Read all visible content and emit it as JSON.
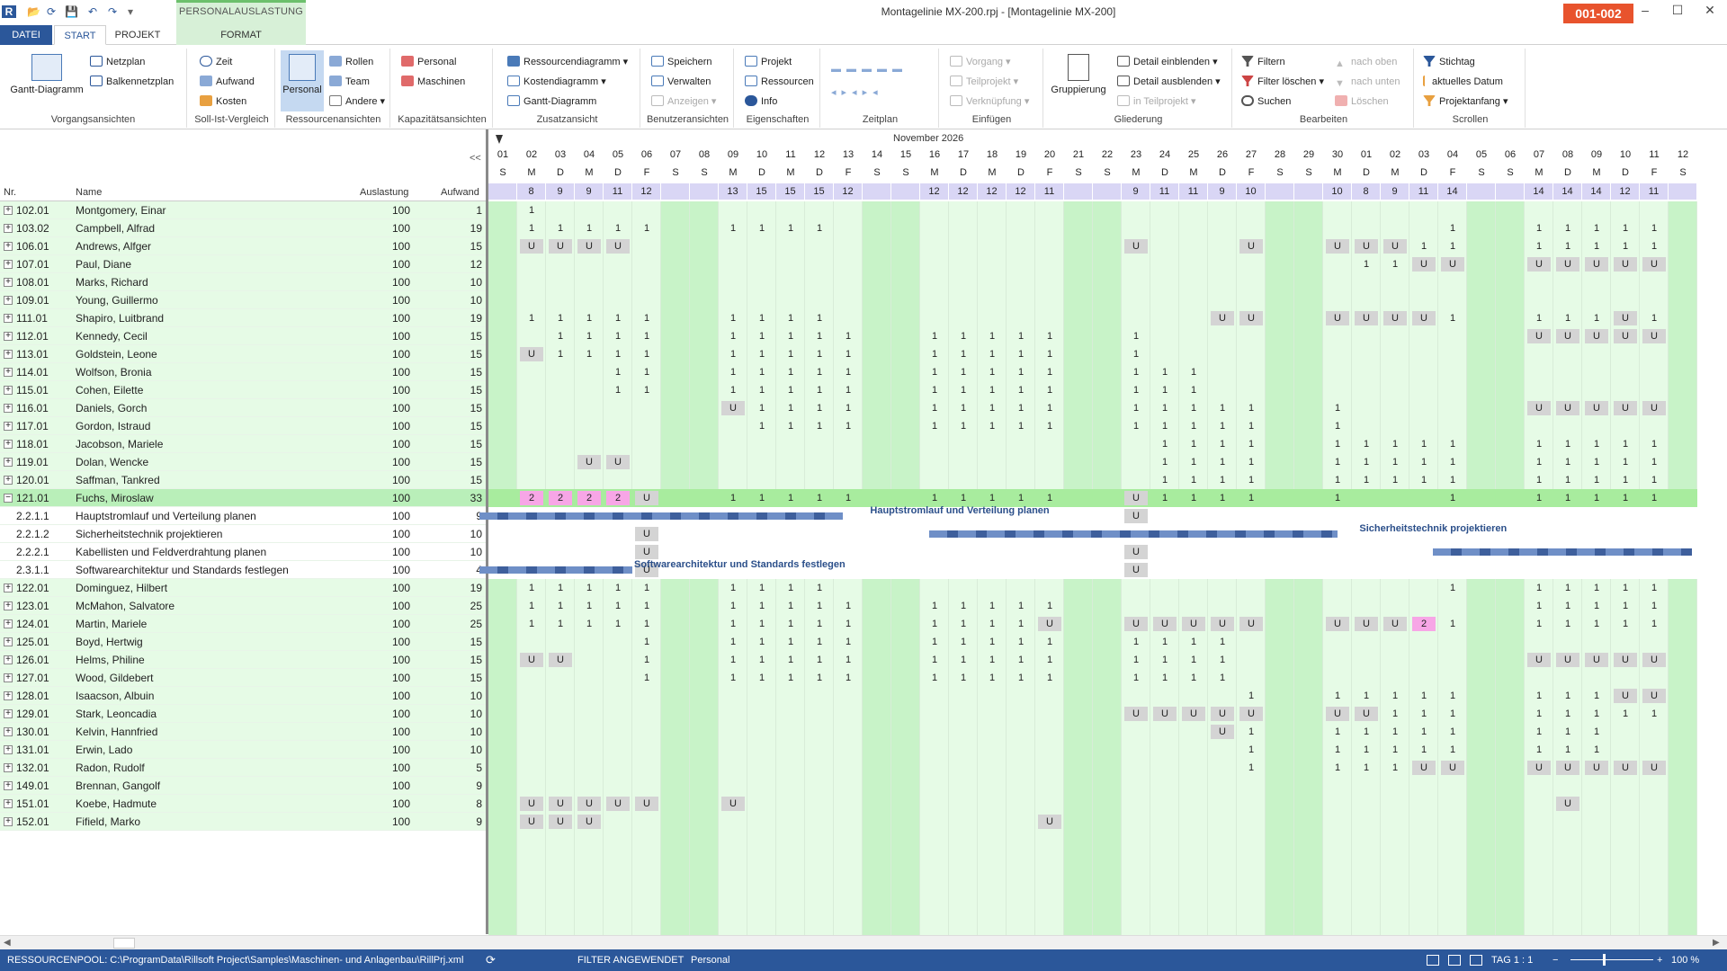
{
  "titlebar": {
    "title": "Montagelinie MX-200.rpj - [Montagelinie MX-200]",
    "context_group": "PERSONALAUSLASTUNG",
    "badge": "001-002",
    "min": "–",
    "max": "☐",
    "close": "✕"
  },
  "tabs": {
    "file": "DATEI",
    "start": "START",
    "project": "PROJEKT",
    "format": "FORMAT"
  },
  "ribbon": {
    "vorgangsansichten": {
      "label": "Vorgangsansichten",
      "gantt": "Gantt-Diagramm",
      "netzplan": "Netzplan",
      "balken": "Balkennetzplan"
    },
    "sollist": {
      "label": "Soll-Ist-Vergleich",
      "zeit": "Zeit",
      "aufwand": "Aufwand",
      "kosten": "Kosten"
    },
    "ressourcen": {
      "label": "Ressourcenansichten",
      "personal": "Personal",
      "rollen": "Rollen",
      "team": "Team",
      "andere": "Andere"
    },
    "kapazitaet": {
      "label": "Kapazitätsansichten",
      "personal": "Personal",
      "maschinen": "Maschinen"
    },
    "zusatz": {
      "label": "Zusatzansicht",
      "rdiagramm": "Ressourcendiagramm",
      "kdiagramm": "Kostendiagramm",
      "gantt": "Gantt-Diagramm"
    },
    "benutzer": {
      "label": "Benutzeransichten",
      "speichern": "Speichern",
      "verwalten": "Verwalten",
      "anzeigen": "Anzeigen"
    },
    "eigenschaften": {
      "label": "Eigenschaften",
      "projekt": "Projekt",
      "ressourcen": "Ressourcen",
      "info": "Info"
    },
    "zeitplan": {
      "label": "Zeitplan"
    },
    "einfuegen": {
      "label": "Einfügen",
      "vorgang": "Vorgang",
      "teilprojekt": "Teilprojekt",
      "verknuepfung": "Verknüpfung"
    },
    "gliederung": {
      "label": "Gliederung",
      "gruppierung": "Gruppierung",
      "einblenden": "Detail einblenden",
      "ausblenden": "Detail ausblenden",
      "teilprojekt": "in Teilprojekt"
    },
    "bearbeiten": {
      "label": "Bearbeiten",
      "filtern": "Filtern",
      "filterloeschen": "Filter löschen",
      "suchen": "Suchen",
      "oben": "nach oben",
      "unten": "nach unten",
      "loeschen": "Löschen"
    },
    "scrollen": {
      "label": "Scrollen",
      "stichtag": "Stichtag",
      "aktuell": "aktuelles Datum",
      "projektanfang": "Projektanfang"
    }
  },
  "table": {
    "col_nr": "Nr.",
    "col_name": "Name",
    "col_auslastung": "Auslastung",
    "col_aufwand": "Aufwand",
    "collapse": "<<"
  },
  "timeline": {
    "month": "November 2026",
    "days": [
      "01",
      "02",
      "03",
      "04",
      "05",
      "06",
      "07",
      "08",
      "09",
      "10",
      "11",
      "12",
      "13",
      "14",
      "15",
      "16",
      "17",
      "18",
      "19",
      "20",
      "21",
      "22",
      "23",
      "24",
      "25",
      "26",
      "27",
      "28",
      "29",
      "30",
      "01",
      "02",
      "03",
      "04",
      "05",
      "06",
      "07",
      "08",
      "09",
      "10",
      "11",
      "12"
    ],
    "letters": [
      "S",
      "M",
      "D",
      "M",
      "D",
      "F",
      "S",
      "S",
      "M",
      "D",
      "M",
      "D",
      "F",
      "S",
      "S",
      "M",
      "D",
      "M",
      "D",
      "F",
      "S",
      "S",
      "M",
      "D",
      "M",
      "D",
      "F",
      "S",
      "S",
      "M",
      "D",
      "M",
      "D",
      "F",
      "S",
      "S",
      "M",
      "D",
      "M",
      "D",
      "F",
      "S"
    ],
    "capacity": [
      "",
      "8",
      "9",
      "9",
      "11",
      "12",
      "",
      "",
      "13",
      "15",
      "15",
      "15",
      "12",
      "",
      "",
      "12",
      "12",
      "12",
      "12",
      "11",
      "",
      "",
      "9",
      "11",
      "11",
      "9",
      "10",
      "",
      "",
      "10",
      "8",
      "9",
      "11",
      "14",
      "",
      "",
      "14",
      "14",
      "14",
      "12",
      "11",
      ""
    ]
  },
  "rows": [
    {
      "nr": "102.01",
      "name": "Montgomery, Einar",
      "ausl": "100",
      "aufw": "1",
      "exp": "+",
      "v": {
        "1": "1"
      }
    },
    {
      "nr": "103.02",
      "name": "Campbell, Alfrad",
      "ausl": "100",
      "aufw": "19",
      "exp": "+",
      "v": {
        "1": "1",
        "2": "1",
        "3": "1",
        "4": "1",
        "5": "1",
        "8": "1",
        "9": "1",
        "10": "1",
        "11": "1",
        "33": "1",
        "36": "1",
        "37": "1",
        "38": "1",
        "39": "1",
        "40": "1"
      }
    },
    {
      "nr": "106.01",
      "name": "Andrews, Alfger",
      "ausl": "100",
      "aufw": "15",
      "exp": "+",
      "v": {
        "1": "U",
        "2": "U",
        "3": "U",
        "4": "U",
        "22": "U",
        "26": "U",
        "29": "U",
        "30": "U",
        "31": "U",
        "32": "1",
        "33": "1",
        "36": "1",
        "37": "1",
        "38": "1",
        "39": "1",
        "40": "1"
      }
    },
    {
      "nr": "107.01",
      "name": "Paul, Diane",
      "ausl": "100",
      "aufw": "12",
      "exp": "+",
      "v": {
        "30": "1",
        "31": "1",
        "32": "U",
        "33": "U",
        "36": "U",
        "37": "U",
        "38": "U",
        "39": "U",
        "40": "U"
      }
    },
    {
      "nr": "108.01",
      "name": "Marks, Richard",
      "ausl": "100",
      "aufw": "10",
      "exp": "+",
      "v": {}
    },
    {
      "nr": "109.01",
      "name": "Young, Guillermo",
      "ausl": "100",
      "aufw": "10",
      "exp": "+",
      "v": {}
    },
    {
      "nr": "111.01",
      "name": "Shapiro, Luitbrand",
      "ausl": "100",
      "aufw": "19",
      "exp": "+",
      "v": {
        "1": "1",
        "2": "1",
        "3": "1",
        "4": "1",
        "5": "1",
        "8": "1",
        "9": "1",
        "10": "1",
        "11": "1",
        "25": "U",
        "26": "U",
        "29": "U",
        "30": "U",
        "31": "U",
        "32": "U",
        "33": "1",
        "36": "1",
        "37": "1",
        "38": "1",
        "39": "U",
        "40": "1"
      }
    },
    {
      "nr": "112.01",
      "name": "Kennedy, Cecil",
      "ausl": "100",
      "aufw": "15",
      "exp": "+",
      "v": {
        "2": "1",
        "3": "1",
        "4": "1",
        "5": "1",
        "8": "1",
        "9": "1",
        "10": "1",
        "11": "1",
        "12": "1",
        "15": "1",
        "16": "1",
        "17": "1",
        "18": "1",
        "19": "1",
        "22": "1",
        "36": "U",
        "37": "U",
        "38": "U",
        "39": "U",
        "40": "U"
      }
    },
    {
      "nr": "113.01",
      "name": "Goldstein, Leone",
      "ausl": "100",
      "aufw": "15",
      "exp": "+",
      "v": {
        "1": "U",
        "2": "1",
        "3": "1",
        "4": "1",
        "5": "1",
        "8": "1",
        "9": "1",
        "10": "1",
        "11": "1",
        "12": "1",
        "15": "1",
        "16": "1",
        "17": "1",
        "18": "1",
        "19": "1",
        "22": "1"
      }
    },
    {
      "nr": "114.01",
      "name": "Wolfson, Bronia",
      "ausl": "100",
      "aufw": "15",
      "exp": "+",
      "v": {
        "4": "1",
        "5": "1",
        "8": "1",
        "9": "1",
        "10": "1",
        "11": "1",
        "12": "1",
        "15": "1",
        "16": "1",
        "17": "1",
        "18": "1",
        "19": "1",
        "22": "1",
        "23": "1",
        "24": "1"
      }
    },
    {
      "nr": "115.01",
      "name": "Cohen, Eilette",
      "ausl": "100",
      "aufw": "15",
      "exp": "+",
      "v": {
        "4": "1",
        "5": "1",
        "8": "1",
        "9": "1",
        "10": "1",
        "11": "1",
        "12": "1",
        "15": "1",
        "16": "1",
        "17": "1",
        "18": "1",
        "19": "1",
        "22": "1",
        "23": "1",
        "24": "1"
      }
    },
    {
      "nr": "116.01",
      "name": "Daniels, Gorch",
      "ausl": "100",
      "aufw": "15",
      "exp": "+",
      "v": {
        "8": "U",
        "9": "1",
        "10": "1",
        "11": "1",
        "12": "1",
        "15": "1",
        "16": "1",
        "17": "1",
        "18": "1",
        "19": "1",
        "22": "1",
        "23": "1",
        "24": "1",
        "25": "1",
        "26": "1",
        "29": "1",
        "36": "U",
        "37": "U",
        "38": "U",
        "39": "U",
        "40": "U"
      }
    },
    {
      "nr": "117.01",
      "name": "Gordon, Istraud",
      "ausl": "100",
      "aufw": "15",
      "exp": "+",
      "v": {
        "9": "1",
        "10": "1",
        "11": "1",
        "12": "1",
        "15": "1",
        "16": "1",
        "17": "1",
        "18": "1",
        "19": "1",
        "22": "1",
        "23": "1",
        "24": "1",
        "25": "1",
        "26": "1",
        "29": "1"
      }
    },
    {
      "nr": "118.01",
      "name": "Jacobson, Mariele",
      "ausl": "100",
      "aufw": "15",
      "exp": "+",
      "v": {
        "23": "1",
        "24": "1",
        "25": "1",
        "26": "1",
        "29": "1",
        "30": "1",
        "31": "1",
        "32": "1",
        "33": "1",
        "36": "1",
        "37": "1",
        "38": "1",
        "39": "1",
        "40": "1"
      }
    },
    {
      "nr": "119.01",
      "name": "Dolan, Wencke",
      "ausl": "100",
      "aufw": "15",
      "exp": "+",
      "v": {
        "3": "U",
        "4": "U",
        "23": "1",
        "24": "1",
        "25": "1",
        "26": "1",
        "29": "1",
        "30": "1",
        "31": "1",
        "32": "1",
        "33": "1",
        "36": "1",
        "37": "1",
        "38": "1",
        "39": "1",
        "40": "1"
      }
    },
    {
      "nr": "120.01",
      "name": "Saffman, Tankred",
      "ausl": "100",
      "aufw": "15",
      "exp": "+",
      "v": {
        "23": "1",
        "24": "1",
        "25": "1",
        "26": "1",
        "29": "1",
        "30": "1",
        "31": "1",
        "32": "1",
        "33": "1",
        "36": "1",
        "37": "1",
        "38": "1",
        "39": "1",
        "40": "1"
      }
    },
    {
      "nr": "121.01",
      "name": "Fuchs, Miroslaw",
      "ausl": "100",
      "aufw": "33",
      "exp": "−",
      "sel": true,
      "v": {
        "1": "2",
        "2": "2",
        "3": "2",
        "4": "2",
        "5": "U",
        "8": "1",
        "9": "1",
        "10": "1",
        "11": "1",
        "12": "1",
        "15": "1",
        "16": "1",
        "17": "1",
        "18": "1",
        "19": "1",
        "22": "U",
        "23": "1",
        "24": "1",
        "25": "1",
        "26": "1",
        "29": "1",
        "33": "1",
        "36": "1",
        "37": "1",
        "38": "1",
        "39": "1",
        "40": "1"
      }
    },
    {
      "nr": "2.2.1.1",
      "name": "Hauptstromlauf und Verteilung planen",
      "ausl": "100",
      "aufw": "9",
      "child": true,
      "v": {
        "22": "U"
      }
    },
    {
      "nr": "2.2.1.2",
      "name": "Sicherheitstechnik projektieren",
      "ausl": "100",
      "aufw": "10",
      "child": true,
      "v": {
        "5": "U"
      }
    },
    {
      "nr": "2.2.2.1",
      "name": "Kabellisten und Feldverdrahtung planen",
      "ausl": "100",
      "aufw": "10",
      "child": true,
      "v": {
        "5": "U",
        "22": "U"
      }
    },
    {
      "nr": "2.3.1.1",
      "name": "Softwarearchitektur und Standards festlegen",
      "ausl": "100",
      "aufw": "4",
      "child": true,
      "v": {
        "5": "U",
        "22": "U"
      }
    },
    {
      "nr": "122.01",
      "name": "Dominguez, Hilbert",
      "ausl": "100",
      "aufw": "19",
      "exp": "+",
      "v": {
        "1": "1",
        "2": "1",
        "3": "1",
        "4": "1",
        "5": "1",
        "8": "1",
        "9": "1",
        "10": "1",
        "11": "1",
        "33": "1",
        "36": "1",
        "37": "1",
        "38": "1",
        "39": "1",
        "40": "1"
      }
    },
    {
      "nr": "123.01",
      "name": "McMahon, Salvatore",
      "ausl": "100",
      "aufw": "25",
      "exp": "+",
      "v": {
        "1": "1",
        "2": "1",
        "3": "1",
        "4": "1",
        "5": "1",
        "8": "1",
        "9": "1",
        "10": "1",
        "11": "1",
        "12": "1",
        "15": "1",
        "16": "1",
        "17": "1",
        "18": "1",
        "19": "1",
        "36": "1",
        "37": "1",
        "38": "1",
        "39": "1",
        "40": "1"
      }
    },
    {
      "nr": "124.01",
      "name": "Martin, Mariele",
      "ausl": "100",
      "aufw": "25",
      "exp": "+",
      "v": {
        "1": "1",
        "2": "1",
        "3": "1",
        "4": "1",
        "5": "1",
        "8": "1",
        "9": "1",
        "10": "1",
        "11": "1",
        "12": "1",
        "15": "1",
        "16": "1",
        "17": "1",
        "18": "1",
        "19": "U",
        "22": "U",
        "23": "U",
        "24": "U",
        "25": "U",
        "26": "U",
        "29": "U",
        "30": "U",
        "31": "U",
        "32": "2",
        "33": "1",
        "36": "1",
        "37": "1",
        "38": "1",
        "39": "1",
        "40": "1"
      }
    },
    {
      "nr": "125.01",
      "name": "Boyd, Hertwig",
      "ausl": "100",
      "aufw": "15",
      "exp": "+",
      "v": {
        "5": "1",
        "8": "1",
        "9": "1",
        "10": "1",
        "11": "1",
        "12": "1",
        "15": "1",
        "16": "1",
        "17": "1",
        "18": "1",
        "19": "1",
        "22": "1",
        "23": "1",
        "24": "1",
        "25": "1"
      }
    },
    {
      "nr": "126.01",
      "name": "Helms, Philine",
      "ausl": "100",
      "aufw": "15",
      "exp": "+",
      "v": {
        "1": "U",
        "2": "U",
        "5": "1",
        "8": "1",
        "9": "1",
        "10": "1",
        "11": "1",
        "12": "1",
        "15": "1",
        "16": "1",
        "17": "1",
        "18": "1",
        "19": "1",
        "22": "1",
        "23": "1",
        "24": "1",
        "25": "1",
        "36": "U",
        "37": "U",
        "38": "U",
        "39": "U",
        "40": "U"
      }
    },
    {
      "nr": "127.01",
      "name": "Wood, Gildebert",
      "ausl": "100",
      "aufw": "15",
      "exp": "+",
      "v": {
        "5": "1",
        "8": "1",
        "9": "1",
        "10": "1",
        "11": "1",
        "12": "1",
        "15": "1",
        "16": "1",
        "17": "1",
        "18": "1",
        "19": "1",
        "22": "1",
        "23": "1",
        "24": "1",
        "25": "1"
      }
    },
    {
      "nr": "128.01",
      "name": "Isaacson, Albuin",
      "ausl": "100",
      "aufw": "10",
      "exp": "+",
      "v": {
        "26": "1",
        "29": "1",
        "30": "1",
        "31": "1",
        "32": "1",
        "33": "1",
        "36": "1",
        "37": "1",
        "38": "1",
        "39": "U",
        "40": "U"
      }
    },
    {
      "nr": "129.01",
      "name": "Stark, Leoncadia",
      "ausl": "100",
      "aufw": "10",
      "exp": "+",
      "v": {
        "22": "U",
        "23": "U",
        "24": "U",
        "25": "U",
        "26": "U",
        "29": "U",
        "30": "U",
        "31": "1",
        "32": "1",
        "33": "1",
        "36": "1",
        "37": "1",
        "38": "1",
        "39": "1",
        "40": "1"
      }
    },
    {
      "nr": "130.01",
      "name": "Kelvin, Hannfried",
      "ausl": "100",
      "aufw": "10",
      "exp": "+",
      "v": {
        "25": "U",
        "26": "1",
        "29": "1",
        "30": "1",
        "31": "1",
        "32": "1",
        "33": "1",
        "36": "1",
        "37": "1",
        "38": "1"
      }
    },
    {
      "nr": "131.01",
      "name": "Erwin, Lado",
      "ausl": "100",
      "aufw": "10",
      "exp": "+",
      "v": {
        "26": "1",
        "29": "1",
        "30": "1",
        "31": "1",
        "32": "1",
        "33": "1",
        "36": "1",
        "37": "1",
        "38": "1"
      }
    },
    {
      "nr": "132.01",
      "name": "Radon, Rudolf",
      "ausl": "100",
      "aufw": "5",
      "exp": "+",
      "v": {
        "26": "1",
        "29": "1",
        "30": "1",
        "31": "1",
        "32": "U",
        "33": "U",
        "36": "U",
        "37": "U",
        "38": "U",
        "39": "U",
        "40": "U"
      }
    },
    {
      "nr": "149.01",
      "name": "Brennan, Gangolf",
      "ausl": "100",
      "aufw": "9",
      "exp": "+",
      "v": {}
    },
    {
      "nr": "151.01",
      "name": "Koebe, Hadmute",
      "ausl": "100",
      "aufw": "8",
      "exp": "+",
      "v": {
        "1": "U",
        "2": "U",
        "3": "U",
        "4": "U",
        "5": "U",
        "8": "U",
        "37": "U"
      }
    },
    {
      "nr": "152.01",
      "name": "Fifield, Marko",
      "ausl": "100",
      "aufw": "9",
      "exp": "+",
      "v": {
        "1": "U",
        "2": "U",
        "3": "U",
        "19": "U"
      }
    }
  ],
  "gantt_labels": {
    "b1": "Hauptstromlauf und Verteilung planen",
    "b2": "Sicherheitstechnik projektieren",
    "b4": "Softwarearchitektur und Standards festlegen"
  },
  "status": {
    "pool": "RESSOURCENPOOL: C:\\ProgramData\\Rillsoft Project\\Samples\\Maschinen- und Anlagenbau\\RillPrj.xml",
    "filter": "FILTER ANGEWENDET",
    "view": "Personal",
    "tag": "TAG 1 : 1",
    "zoom": "100 %"
  },
  "colors": {
    "accent": "#2b579a",
    "weekend": "#c8f3c8",
    "weekday": "#e6fbe6",
    "selected": "#b9efb9",
    "overload": "#f7a6e6",
    "vacation": "#d4d4d4",
    "badge": "#e8532d"
  }
}
